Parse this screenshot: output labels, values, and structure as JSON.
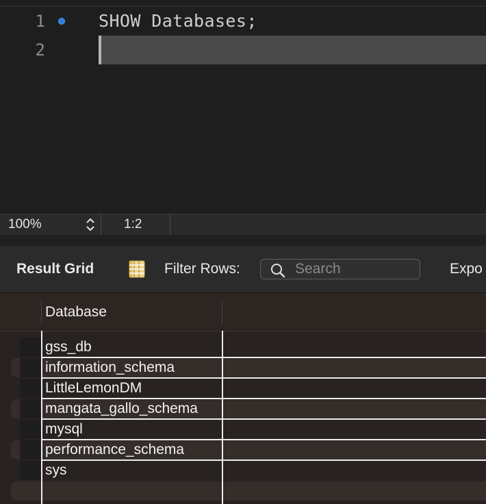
{
  "editor": {
    "lines": [
      {
        "number": "1",
        "code": "SHOW Databases;"
      },
      {
        "number": "2",
        "code": ""
      }
    ]
  },
  "statusbar": {
    "zoom": "100%",
    "cursor_position": "1:2"
  },
  "result_toolbar": {
    "title": "Result Grid",
    "filter_label": "Filter Rows:",
    "search_placeholder": "Search",
    "export_label": "Expo"
  },
  "grid": {
    "columns": [
      "Database"
    ],
    "rows": [
      "gss_db",
      "information_schema",
      "LittleLemonDM",
      "mangata_gallo_schema",
      "mysql",
      "performance_schema",
      "sys"
    ]
  },
  "colors": {
    "accent_marker": "#2f7fd6",
    "editor_bg": "#1e1e1e",
    "grid_bg": "#282220"
  }
}
